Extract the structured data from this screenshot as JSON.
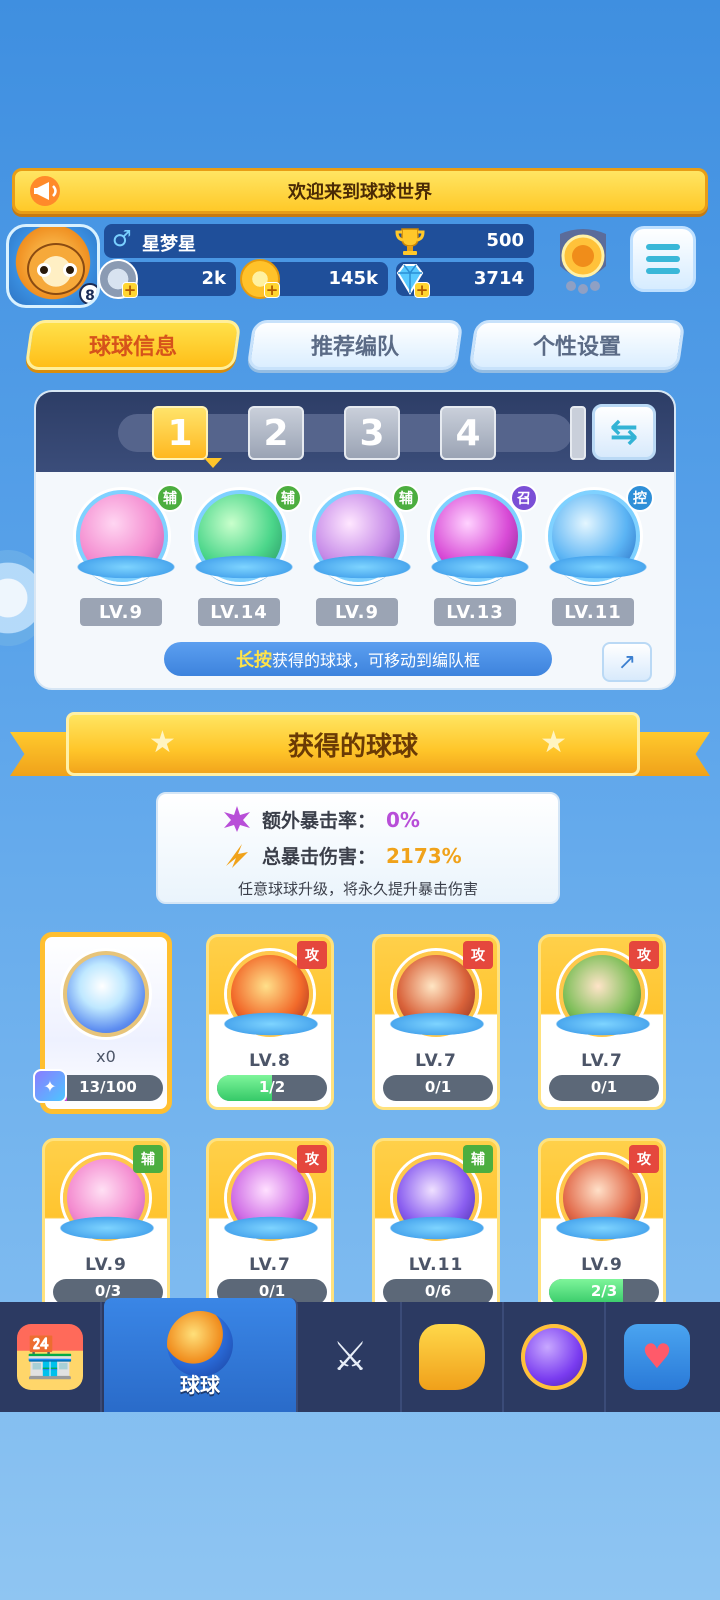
{
  "welcome_banner": "欢迎来到球球世界",
  "profile": {
    "level": "8",
    "gender_symbol": "♂",
    "name": "星梦星",
    "trophies": "500",
    "energy": "2k",
    "coins": "145k",
    "diamonds": "3714"
  },
  "tabs": [
    "球球信息",
    "推荐编队",
    "个性设置"
  ],
  "lineup": {
    "slots": [
      "1",
      "2",
      "3",
      "4"
    ],
    "balls": [
      {
        "role": "辅",
        "level": "LV.9"
      },
      {
        "role": "辅",
        "level": "LV.14"
      },
      {
        "role": "辅",
        "level": "LV.9"
      },
      {
        "role": "召",
        "level": "LV.13"
      },
      {
        "role": "控",
        "level": "LV.11"
      }
    ],
    "hint_highlight": "长按",
    "hint_text": "获得的球球，可移动到编队框"
  },
  "section_title": "获得的球球",
  "crit": {
    "extra_rate_label": "额外暴击率：",
    "extra_rate_value": "0%",
    "total_damage_label": "总暴击伤害：",
    "total_damage_value": "2173%",
    "note": "任意球球升级，将永久提升暴击伤害"
  },
  "special_card": {
    "count": "x0",
    "progress_text": "13/100",
    "progress": 0.13
  },
  "ball_cards": [
    {
      "tag": "攻",
      "level": "LV.8",
      "progress_text": "1/2",
      "progress": 0.5
    },
    {
      "tag": "攻",
      "level": "LV.7",
      "progress_text": "0/1",
      "progress": 0
    },
    {
      "tag": "攻",
      "level": "LV.7",
      "progress_text": "0/1",
      "progress": 0
    },
    {
      "tag": "辅",
      "level": "LV.9",
      "progress_text": "0/3",
      "progress": 0
    },
    {
      "tag": "攻",
      "level": "LV.7",
      "progress_text": "0/1",
      "progress": 0
    },
    {
      "tag": "辅",
      "level": "LV.11",
      "progress_text": "0/6",
      "progress": 0
    },
    {
      "tag": "攻",
      "level": "LV.9",
      "progress_text": "2/3",
      "progress": 0.67
    }
  ],
  "nav": {
    "active_label": "球球",
    "icons": [
      "shop-icon",
      "ball-collection-icon",
      "battle-swords-icon",
      "whistle-icon",
      "planet-icon",
      "chat-heart-icon"
    ]
  },
  "colors": {
    "support_tag": "#4cae3f",
    "summon_tag": "#7b4fd6",
    "control_tag": "#2e8fd8",
    "attack_tag": "#e5473d",
    "crit_rate": "#b84ed8",
    "crit_damage": "#f0a21a"
  }
}
